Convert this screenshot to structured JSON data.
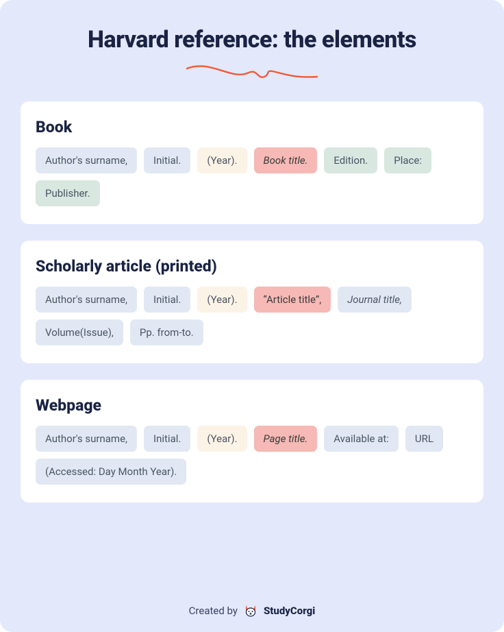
{
  "title": "Harvard reference: the elements",
  "sections": [
    {
      "title": "Book",
      "pills": [
        {
          "text": "Author's surname,",
          "cls": "blue"
        },
        {
          "text": "Initial.",
          "cls": "blue"
        },
        {
          "text": "(Year).",
          "cls": "cream"
        },
        {
          "text": "Book title.",
          "cls": "red italic"
        },
        {
          "text": "Edition.",
          "cls": "sage"
        },
        {
          "text": "Place:",
          "cls": "sage"
        },
        {
          "text": "Publisher.",
          "cls": "sage"
        }
      ]
    },
    {
      "title": "Scholarly article (printed)",
      "pills": [
        {
          "text": "Author's surname,",
          "cls": "blue"
        },
        {
          "text": "Initial.",
          "cls": "blue"
        },
        {
          "text": "(Year).",
          "cls": "cream"
        },
        {
          "text": "“Article title”,",
          "cls": "red"
        },
        {
          "text": "Journal title,",
          "cls": "blue italic"
        },
        {
          "text": "Volume(Issue),",
          "cls": "blue"
        },
        {
          "text": "Pp. from-to.",
          "cls": "blue"
        }
      ]
    },
    {
      "title": "Webpage",
      "pills": [
        {
          "text": "Author's surname,",
          "cls": "blue"
        },
        {
          "text": "Initial.",
          "cls": "blue"
        },
        {
          "text": "(Year).",
          "cls": "cream"
        },
        {
          "text": "Page title.",
          "cls": "red italic"
        },
        {
          "text": "Available at:",
          "cls": "blue"
        },
        {
          "text": "URL",
          "cls": "blue"
        },
        {
          "text": "(Accessed: Day Month Year).",
          "cls": "blue"
        }
      ]
    }
  ],
  "footer": {
    "created_by": "Created by",
    "brand": "StudyCorgi"
  }
}
